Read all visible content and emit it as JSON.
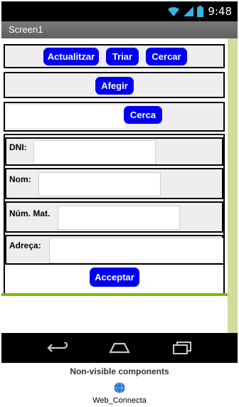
{
  "status_bar": {
    "time": "9:48"
  },
  "title_bar": {
    "title": "Screen1"
  },
  "toolbar": {
    "refresh_label": "Actualitzar",
    "select_label": "Triar",
    "search_label": "Cercar"
  },
  "add_row": {
    "add_label": "Afegir"
  },
  "search_row": {
    "query_value": "",
    "search_label": "Cerca"
  },
  "form": {
    "dni_label": "DNI:",
    "dni_value": "",
    "name_label": "Nom:",
    "name_value": "",
    "mat_label": "Núm. Mat.",
    "mat_value": "",
    "address_label": "Adreça:",
    "address_value": "",
    "accept_label": "Acceptar"
  },
  "designer": {
    "nonvisible_title": "Non-visible components",
    "component_name": "Web_Connecta",
    "component_icon": "globe-icon"
  },
  "colors": {
    "button": "#0000ee",
    "arrangement_bg": "#efedf0",
    "accent_line": "#7cba00",
    "scroll_strip": "#d2dc9c"
  }
}
